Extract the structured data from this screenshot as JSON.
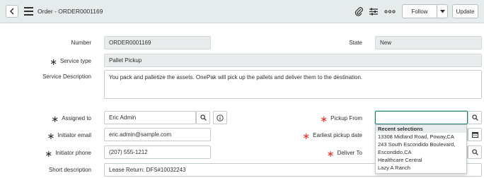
{
  "header": {
    "title": "Order - ORDER0001169",
    "follow_label": "Follow",
    "update_label": "Update"
  },
  "fields": {
    "number": {
      "label": "Number",
      "value": "ORDER0001169"
    },
    "state": {
      "label": "State",
      "value": "New"
    },
    "service_type": {
      "label": "Service type",
      "value": "Pallet Pickup"
    },
    "service_description": {
      "label": "Service Description",
      "value": "You pack and palletize the assets. OnePak will pick up the pallets and deliver them to the destination."
    },
    "assigned_to": {
      "label": "Assigned to",
      "value": "Eric Admin"
    },
    "initiator_email": {
      "label": "Initiator email",
      "value": "eric.admin@sample.com"
    },
    "initiator_phone": {
      "label": "Initiator phone",
      "value": "(207) 555-1212"
    },
    "short_description": {
      "label": "Short description",
      "value": "Lease Return: DFS#10032243"
    },
    "pickup_from": {
      "label": "Pickup From",
      "value": ""
    },
    "earliest_pickup_date": {
      "label": "Earliest pickup date"
    },
    "deliver_to": {
      "label": "Deliver To"
    }
  },
  "recent_selections": {
    "header": "Recent selections",
    "items": [
      "13308 Midland Road, Poway,CA",
      "243 South Escondido Boulevard,",
      "Escondido,CA",
      "Healthcare Central",
      "Lazy A Ranch"
    ]
  },
  "colors": {
    "required_mandatory": "#e0312b",
    "focus_border": "#1f8476",
    "header_bg": "#e6ebec"
  }
}
